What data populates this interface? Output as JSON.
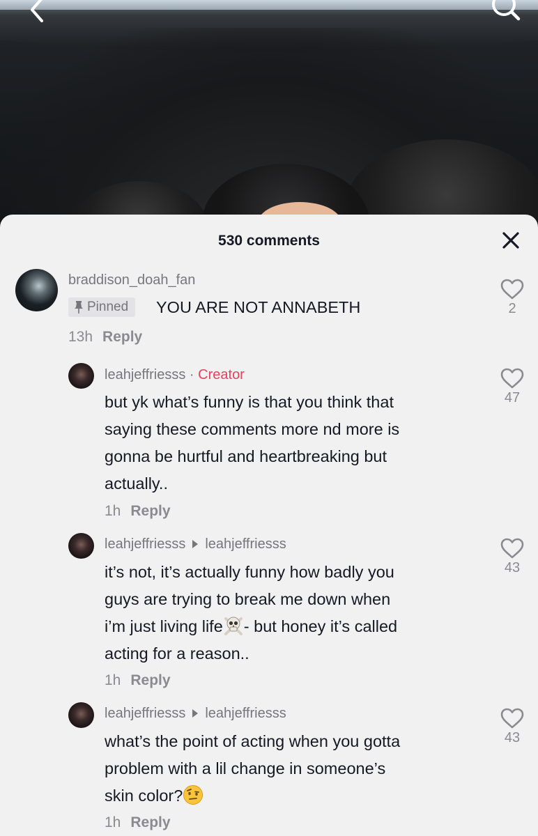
{
  "header": {
    "comment_count_label": "530 comments"
  },
  "comments": [
    {
      "username": "braddison_doah_fan",
      "pinned_label": "Pinned",
      "text": "YOU ARE NOT ANNABETH",
      "time": "13h",
      "reply_label": "Reply",
      "likes": "2"
    }
  ],
  "replies": [
    {
      "username": "leahjeffriesss",
      "separator": "·",
      "creator_tag": "Creator",
      "lines": [
        "but yk what’s funny is that you think that",
        "saying these comments more nd more is",
        "gonna be hurtful and heartbreaking but",
        "actually.."
      ],
      "time": "1h",
      "reply_label": "Reply",
      "likes": "47"
    },
    {
      "username": "leahjeffriesss",
      "reply_to": "leahjeffriesss",
      "lines": [
        "it’s not, it’s actually funny how badly you",
        "guys are trying to break me down when",
        "i’m just living life",
        "- but honey it’s called",
        "acting for a reason.."
      ],
      "emoji": "skull",
      "time": "1h",
      "reply_label": "Reply",
      "likes": "43"
    },
    {
      "username": "leahjeffriesss",
      "reply_to": "leahjeffriesss",
      "lines": [
        "what’s the point of acting when you gotta",
        "problem with a lil change in someone’s",
        "skin color?"
      ],
      "emoji": "face-with-raised-eyebrow",
      "time": "1h",
      "reply_label": "Reply",
      "likes": "43"
    }
  ],
  "colors": {
    "creator": "#e8415d",
    "sheet": "#f1f1f2",
    "text": "#161823",
    "muted": "#8a8a90"
  }
}
